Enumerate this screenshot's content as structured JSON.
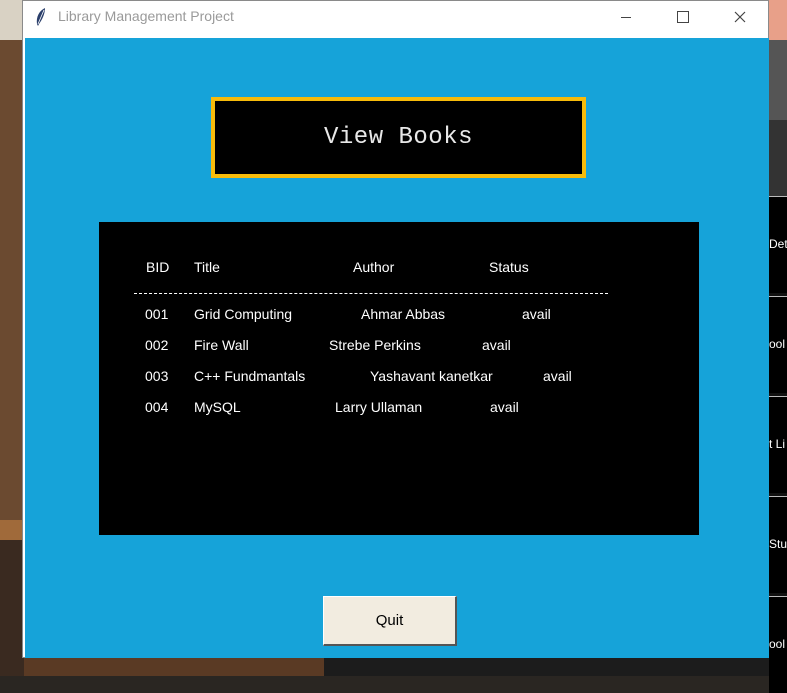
{
  "window": {
    "title": "Library Management Project"
  },
  "heading": "View Books",
  "table": {
    "headers": {
      "bid": "BID",
      "title": "Title",
      "author": "Author",
      "status": "Status"
    },
    "rows": [
      {
        "bid": "001",
        "title": "Grid Computing",
        "author": "Ahmar Abbas",
        "status": "avail"
      },
      {
        "bid": "002",
        "title": "Fire Wall",
        "author": "Strebe Perkins",
        "status": "avail"
      },
      {
        "bid": "003",
        "title": "C++ Fundmantals",
        "author": "Yashavant kanetkar",
        "status": "avail"
      },
      {
        "bid": "004",
        "title": "MySQL",
        "author": "Larry Ullaman",
        "status": "avail"
      }
    ]
  },
  "quit_label": "Quit",
  "background_fragments": [
    "Det",
    "ool",
    "t Li",
    "Stu",
    "ool"
  ],
  "colors": {
    "accent_bg": "#16a3d9",
    "heading_border": "#f7bb0a",
    "panel": "#000000",
    "button_bg": "#f2ece0"
  }
}
